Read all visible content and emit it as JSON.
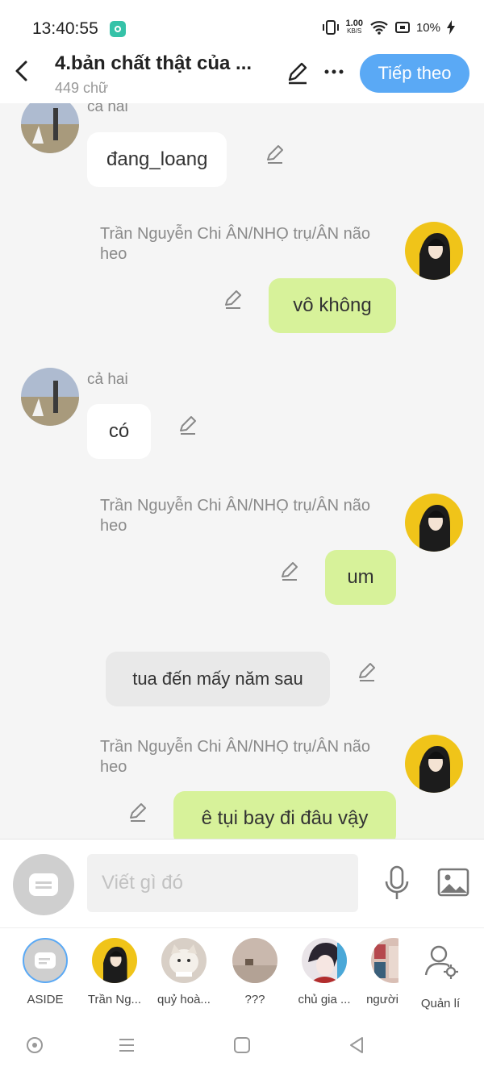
{
  "status_bar": {
    "time": "13:40:55",
    "net_speed_value": "1.00",
    "net_speed_unit": "KB/S",
    "battery": "10%"
  },
  "header": {
    "title": "4.bản chất thật của ...",
    "word_count": "449 chữ",
    "next_label": "Tiếp theo"
  },
  "messages": [
    {
      "sender": "ca hai",
      "text": "đang_loang",
      "side": "left"
    },
    {
      "sender": "Trần Nguyễn Chi ÂN/NHỌ trụ/ÂN não heo",
      "text": "vô không",
      "side": "right"
    },
    {
      "sender": "cả hai",
      "text": "có",
      "side": "left"
    },
    {
      "sender": "Trần Nguyễn Chi ÂN/NHỌ trụ/ÂN não heo",
      "text": "um",
      "side": "right"
    },
    {
      "sender": "",
      "text": "tua đến mấy năm sau",
      "side": "aside"
    },
    {
      "sender": "Trần Nguyễn Chi ÂN/NHỌ trụ/ÂN não heo",
      "text": "ê tụi bay đi đâu vậy",
      "side": "right"
    }
  ],
  "input": {
    "placeholder": "Viết gì đó"
  },
  "characters": [
    {
      "name": "ASIDE"
    },
    {
      "name": "Trần Ng..."
    },
    {
      "name": "quỷ hoà..."
    },
    {
      "name": "???"
    },
    {
      "name": "chủ gia ..."
    },
    {
      "name": "người"
    },
    {
      "name": "Quản lí"
    }
  ],
  "colors": {
    "accent": "#5aa9f5",
    "my_bubble": "#d7f29a",
    "other_bubble": "#ffffff",
    "aside_bubble": "#e9e9e9"
  }
}
